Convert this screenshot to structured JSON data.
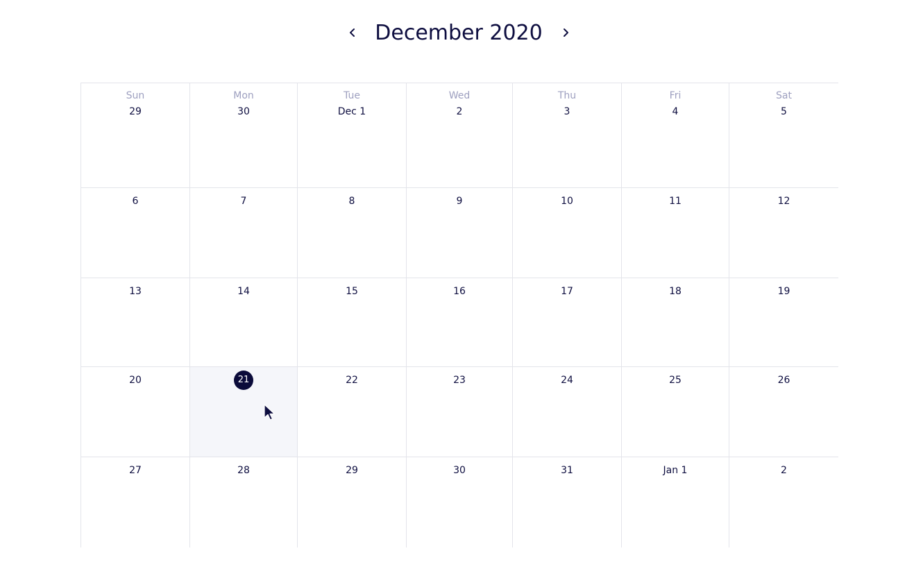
{
  "header": {
    "month_title": "December 2020",
    "prev_icon": "chevron-left-icon",
    "next_icon": "chevron-right-icon"
  },
  "weekdays": [
    "Sun",
    "Mon",
    "Tue",
    "Wed",
    "Thu",
    "Fri",
    "Sat"
  ],
  "weeks": [
    [
      "29",
      "30",
      "Dec 1",
      "2",
      "3",
      "4",
      "5"
    ],
    [
      "6",
      "7",
      "8",
      "9",
      "10",
      "11",
      "12"
    ],
    [
      "13",
      "14",
      "15",
      "16",
      "17",
      "18",
      "19"
    ],
    [
      "20",
      "21",
      "22",
      "23",
      "24",
      "25",
      "26"
    ],
    [
      "27",
      "28",
      "29",
      "30",
      "31",
      "Jan 1",
      "2"
    ]
  ],
  "today": {
    "week": 3,
    "day": 1,
    "label": "21"
  },
  "colors": {
    "text": "#0d0d3f",
    "weekday": "#9d9fbf",
    "grid_line": "#e3e4ea",
    "today_badge": "#0b0b3a",
    "selected_cell": "#f5f6fa"
  }
}
